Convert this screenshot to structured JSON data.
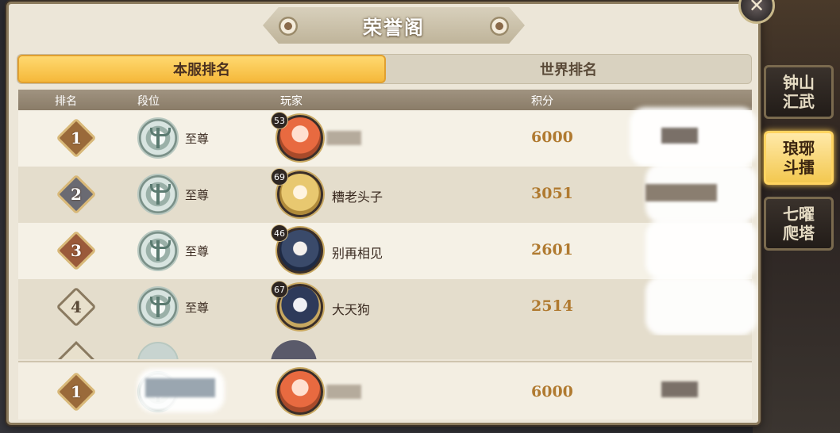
{
  "window": {
    "title": "荣誉阁",
    "close_icon": "close-icon"
  },
  "tabs": [
    {
      "label": "本服排名",
      "active": true
    },
    {
      "label": "世界排名",
      "active": false
    }
  ],
  "table": {
    "headers": {
      "rank": "排名",
      "tier": "段位",
      "player": "玩家",
      "score": "积分",
      "server": ""
    },
    "rows": [
      {
        "rank": "1",
        "tier": "至尊",
        "level": "53",
        "name": "",
        "score": "6000",
        "badge_color": "#9a6a3a"
      },
      {
        "rank": "2",
        "tier": "至尊",
        "level": "69",
        "name": "糟老头子",
        "score": "3051",
        "badge_color": "#6a6a72"
      },
      {
        "rank": "3",
        "tier": "至尊",
        "level": "46",
        "name": "别再相见",
        "score": "2601",
        "badge_color": "#9a5a3a"
      },
      {
        "rank": "4",
        "tier": "至尊",
        "level": "67",
        "name": "大天狗",
        "score": "2514",
        "badge_color": "#d8cdb8"
      }
    ]
  },
  "my_rank": {
    "rank": "1",
    "tier": "",
    "name": "",
    "score": "6000"
  },
  "side_tabs": [
    {
      "label": "钟山汇武",
      "active": false
    },
    {
      "label": "琅琊斗擂",
      "active": true
    },
    {
      "label": "七曜爬塔",
      "active": false
    }
  ],
  "colors": {
    "accent": "#f5b83a",
    "score": "#b07a30",
    "panel": "#ece6d8"
  }
}
